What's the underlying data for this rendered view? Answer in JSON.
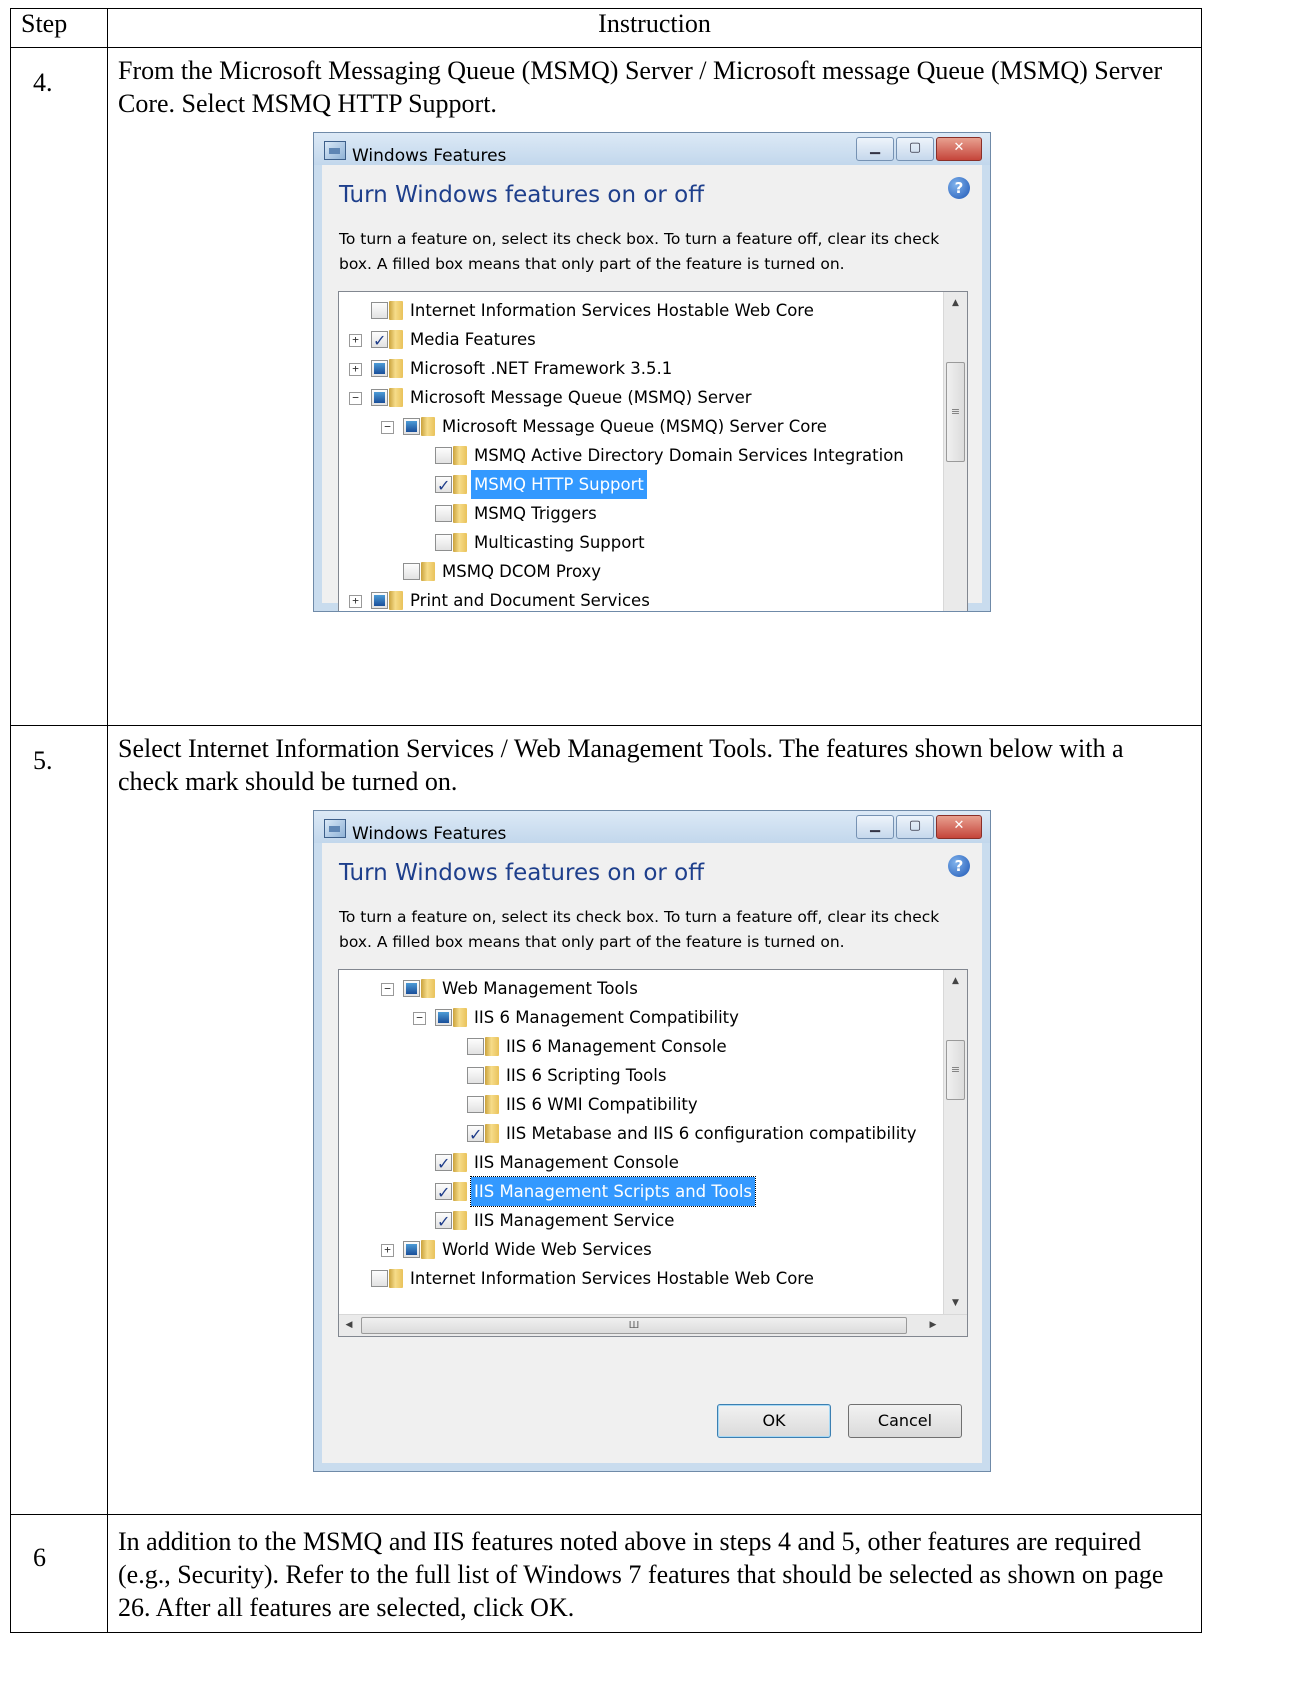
{
  "table": {
    "header_step": "Step",
    "header_instruction": "Instruction",
    "rows": [
      {
        "step": "4.",
        "text": "From the Microsoft Messaging Queue (MSMQ) Server / Microsoft message Queue (MSMQ) Server Core. Select MSMQ HTTP Support."
      },
      {
        "step": "5.",
        "text": "Select Internet Information Services / Web Management Tools. The features shown below with a check mark should be turned on."
      },
      {
        "step": "6",
        "text": "In addition to the MSMQ and IIS features noted above in steps 4 and 5, other features are required (e.g., Security). Refer to the full list of Windows 7 features that should be selected as shown on page 26. After all features are selected, click OK."
      }
    ]
  },
  "dialog": {
    "title": "Windows Features",
    "heading": "Turn Windows features on or off",
    "description": "To turn a feature on, select its check box. To turn a feature off, clear its check box. A filled box means that only part of the feature is turned on.",
    "ok_label": "OK",
    "cancel_label": "Cancel"
  },
  "dialog1_items": [
    {
      "indent": 0,
      "expander": "",
      "state": "unchecked",
      "label": "Internet Information Services Hostable Web Core",
      "selected": false
    },
    {
      "indent": 0,
      "expander": "+",
      "state": "checked",
      "label": "Media Features",
      "selected": false
    },
    {
      "indent": 0,
      "expander": "+",
      "state": "partial",
      "label": "Microsoft .NET Framework 3.5.1",
      "selected": false
    },
    {
      "indent": 0,
      "expander": "-",
      "state": "partial",
      "label": "Microsoft Message Queue (MSMQ) Server",
      "selected": false
    },
    {
      "indent": 1,
      "expander": "-",
      "state": "partial",
      "label": "Microsoft Message Queue (MSMQ) Server Core",
      "selected": false
    },
    {
      "indent": 2,
      "expander": "",
      "state": "unchecked",
      "label": "MSMQ Active Directory Domain Services Integration",
      "selected": false
    },
    {
      "indent": 2,
      "expander": "",
      "state": "checked",
      "label": "MSMQ HTTP Support",
      "selected": true
    },
    {
      "indent": 2,
      "expander": "",
      "state": "unchecked",
      "label": "MSMQ Triggers",
      "selected": false
    },
    {
      "indent": 2,
      "expander": "",
      "state": "unchecked",
      "label": "Multicasting Support",
      "selected": false
    },
    {
      "indent": 1,
      "expander": "",
      "state": "unchecked",
      "label": "MSMQ DCOM Proxy",
      "selected": false
    },
    {
      "indent": 0,
      "expander": "+",
      "state": "partial",
      "label": "Print and Document Services",
      "selected": false
    }
  ],
  "dialog2_items": [
    {
      "indent": 1,
      "expander": "-",
      "state": "partial",
      "label": "Web Management Tools",
      "selected": false
    },
    {
      "indent": 2,
      "expander": "-",
      "state": "partial",
      "label": "IIS 6 Management Compatibility",
      "selected": false
    },
    {
      "indent": 3,
      "expander": "",
      "state": "unchecked",
      "label": "IIS 6 Management Console",
      "selected": false
    },
    {
      "indent": 3,
      "expander": "",
      "state": "unchecked",
      "label": "IIS 6 Scripting Tools",
      "selected": false
    },
    {
      "indent": 3,
      "expander": "",
      "state": "unchecked",
      "label": "IIS 6 WMI Compatibility",
      "selected": false
    },
    {
      "indent": 3,
      "expander": "",
      "state": "checked",
      "label": "IIS Metabase and IIS 6 configuration compatibility",
      "selected": false
    },
    {
      "indent": 2,
      "expander": "",
      "state": "checked",
      "label": "IIS Management Console",
      "selected": false
    },
    {
      "indent": 2,
      "expander": "",
      "state": "checked",
      "label": "IIS Management Scripts and Tools",
      "selected": true
    },
    {
      "indent": 2,
      "expander": "",
      "state": "checked",
      "label": "IIS Management Service",
      "selected": false
    },
    {
      "indent": 1,
      "expander": "+",
      "state": "partial",
      "label": "World Wide Web Services",
      "selected": false
    },
    {
      "indent": 0,
      "expander": "",
      "state": "unchecked",
      "label": "Internet Information Services Hostable Web Core",
      "selected": false
    }
  ]
}
